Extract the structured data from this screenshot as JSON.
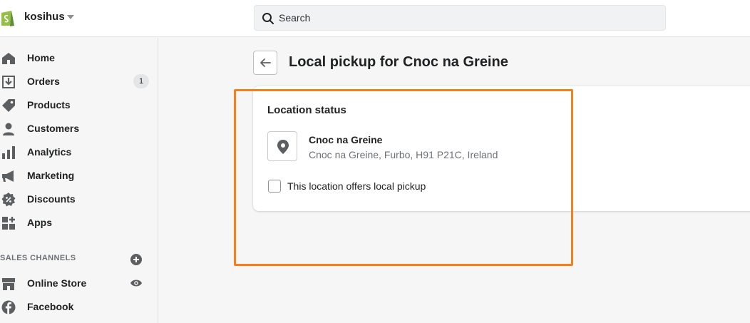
{
  "store": {
    "name": "kosihus"
  },
  "search": {
    "placeholder": "Search"
  },
  "sidebar": {
    "items": [
      {
        "label": "Home"
      },
      {
        "label": "Orders",
        "badge": "1"
      },
      {
        "label": "Products"
      },
      {
        "label": "Customers"
      },
      {
        "label": "Analytics"
      },
      {
        "label": "Marketing"
      },
      {
        "label": "Discounts"
      },
      {
        "label": "Apps"
      }
    ],
    "sales_channels_heading": "SALES CHANNELS",
    "channels": [
      {
        "label": "Online Store"
      },
      {
        "label": "Facebook"
      }
    ]
  },
  "page": {
    "title": "Local pickup for Cnoc na Greine"
  },
  "card": {
    "title": "Location status",
    "location_name": "Cnoc na Greine",
    "location_address": "Cnoc na Greine, Furbo, H91 P21C, Ireland",
    "checkbox_label": "This location offers local pickup",
    "checkbox_checked": false
  },
  "colors": {
    "highlight": "#f77e1a",
    "shopify_green": "#95bf47",
    "icon": "#5c5f62"
  },
  "icons": [
    "shopify-logo-icon",
    "search-icon",
    "home-icon",
    "orders-icon",
    "products-icon",
    "customers-icon",
    "analytics-icon",
    "marketing-icon",
    "discounts-icon",
    "apps-icon",
    "plus-circle-icon",
    "online-store-icon",
    "eye-icon",
    "facebook-icon",
    "arrow-left-icon",
    "location-pin-icon"
  ]
}
